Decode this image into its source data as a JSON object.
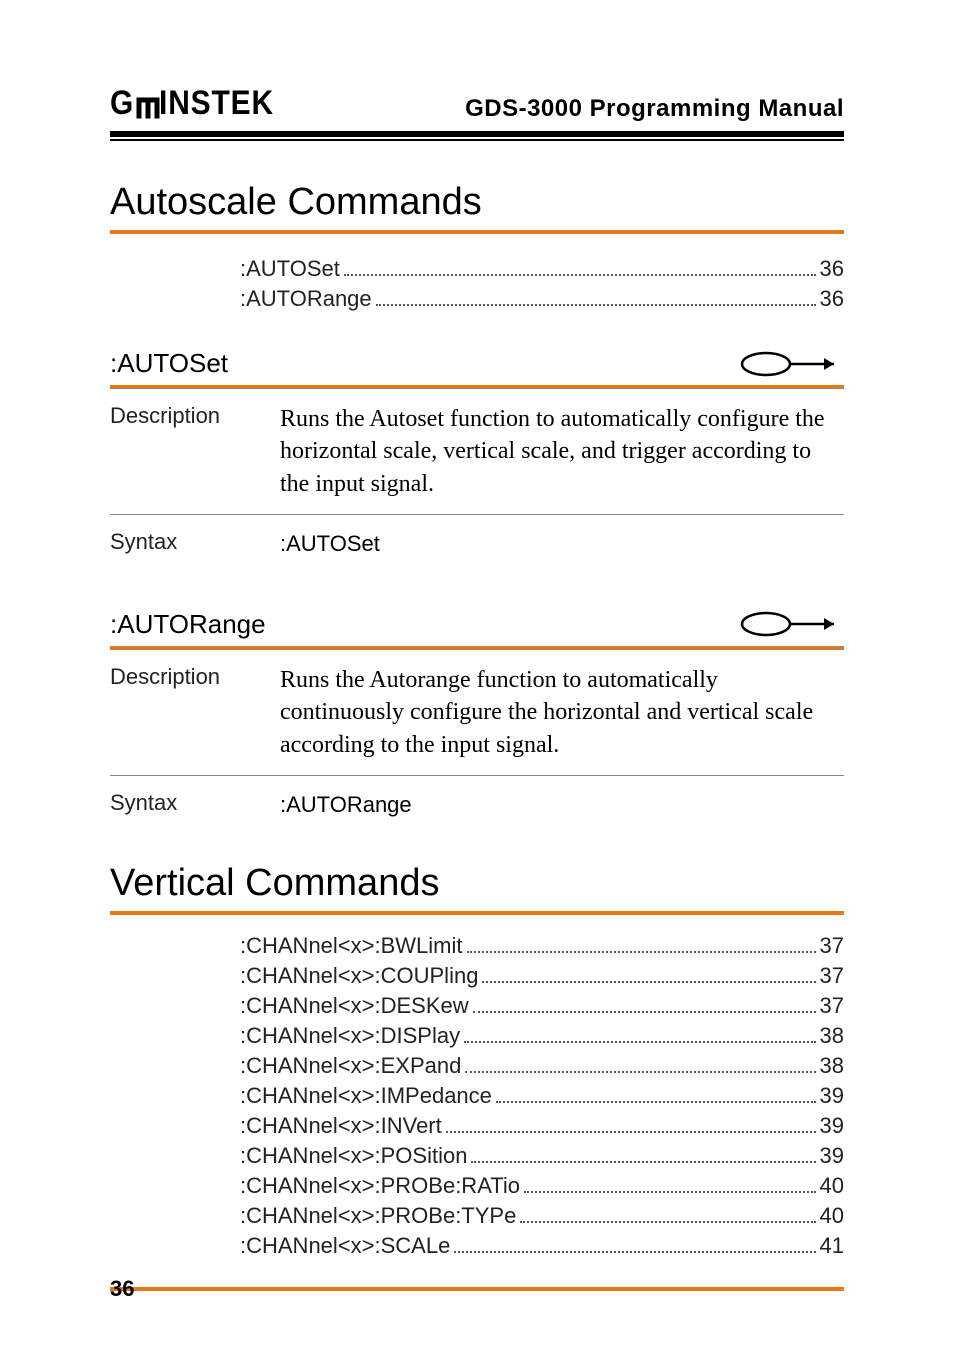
{
  "header": {
    "brand_left": "G",
    "brand_right": "INSTEK",
    "manual_title": "GDS-3000 Programming Manual"
  },
  "sections": {
    "autoscale": {
      "title": "Autoscale Commands",
      "toc": [
        {
          "cmd": ":AUTOSet",
          "page": "36"
        },
        {
          "cmd": ":AUTORange",
          "page": "36"
        }
      ],
      "cmds": {
        "autoset": {
          "name": ":AUTOSet",
          "desc_label": "Description",
          "desc_text": "Runs the Autoset function to automatically configure the horizontal scale, vertical scale, and trigger according to the input signal.",
          "syntax_label": "Syntax",
          "syntax_text": ":AUTOSet"
        },
        "autorange": {
          "name": ":AUTORange",
          "desc_label": "Description",
          "desc_text": "Runs the Autorange function to automatically continuously configure the horizontal and vertical scale according to the input signal.",
          "syntax_label": "Syntax",
          "syntax_text": ":AUTORange"
        }
      }
    },
    "vertical": {
      "title": "Vertical Commands",
      "toc": [
        {
          "cmd": ":CHANnel<x>:BWLimit",
          "page": "37"
        },
        {
          "cmd": ":CHANnel<x>:COUPling",
          "page": "37"
        },
        {
          "cmd": ":CHANnel<x>:DESKew",
          "page": "37"
        },
        {
          "cmd": ":CHANnel<x>:DISPlay",
          "page": "38"
        },
        {
          "cmd": ":CHANnel<x>:EXPand",
          "page": "38"
        },
        {
          "cmd": ":CHANnel<x>:IMPedance",
          "page": "39"
        },
        {
          "cmd": ":CHANnel<x>:INVert",
          "page": "39"
        },
        {
          "cmd": ":CHANnel<x>:POSition",
          "page": "39"
        },
        {
          "cmd": ":CHANnel<x>:PROBe:RATio",
          "page": "40"
        },
        {
          "cmd": ":CHANnel<x>:PROBe:TYPe",
          "page": "40"
        },
        {
          "cmd": ":CHANnel<x>:SCALe",
          "page": "41"
        }
      ]
    }
  },
  "page_number": "36",
  "icons": {
    "set_arrow": "set-arrow-icon"
  }
}
